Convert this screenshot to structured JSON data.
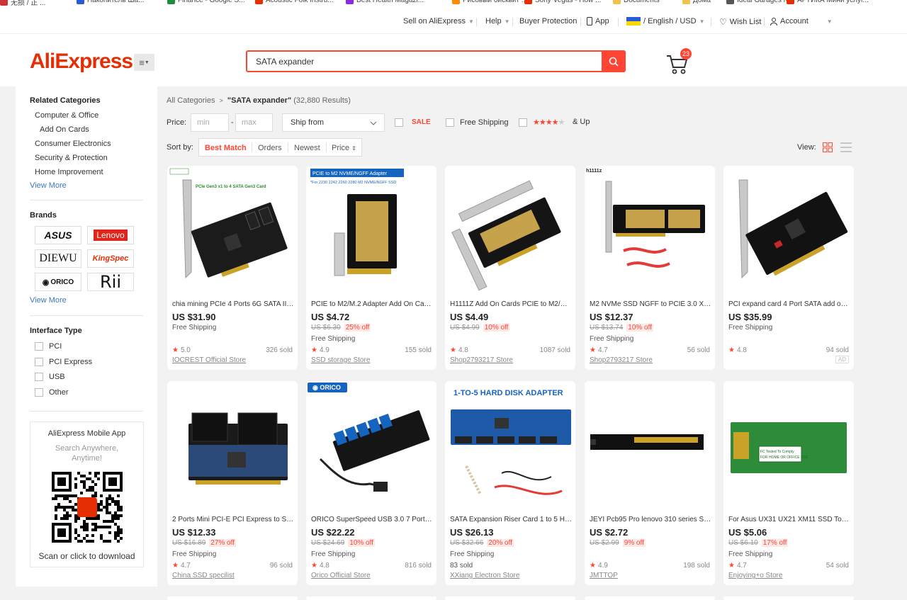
{
  "bookmarks": [
    {
      "label": "无损 / 正 ...",
      "color": "#c33"
    },
    {
      "label": "Накопитель Ша...",
      "color": "#2a5bd7"
    },
    {
      "label": "Finance - Google S...",
      "color": "#1e8e3e"
    },
    {
      "label": "Acoustic Folk Instru...",
      "color": "#e62e04"
    },
    {
      "label": "Best Health Magazi...",
      "color": "#8a2be2"
    },
    {
      "label": "Рисовый бисквит ...",
      "color": "#ff8c00"
    },
    {
      "label": "Sony Vegas - How ...",
      "color": "#e62e04"
    },
    {
      "label": "Documents",
      "color": "#f2c14e"
    },
    {
      "label": "Дома",
      "color": "#f2c14e"
    },
    {
      "label": "Ideal Garages NS",
      "color": "#555"
    },
    {
      "label": "АРТИКА Мини услуг...",
      "color": "#e62e04"
    }
  ],
  "topnav": {
    "sell": "Sell on AliExpress",
    "help": "Help",
    "buyer_protection": "Buyer Protection",
    "app": "App",
    "language_currency": "/ English /  USD",
    "wishlist": "Wish List",
    "account": "Account"
  },
  "header": {
    "logo": "AliExpress",
    "search_value": "SATA expander",
    "cart_count": "23"
  },
  "sidebar": {
    "related_title": "Related Categories",
    "related": [
      "Computer & Office",
      "Add On Cards",
      "Consumer Electronics",
      "Security & Protection",
      "Home Improvement"
    ],
    "view_more": "View More",
    "brands_title": "Brands",
    "brands": [
      "ASUS",
      "Lenovo",
      "DIEWU",
      "KingSpec",
      "ORICO",
      "Rii"
    ],
    "interface_title": "Interface Type",
    "interfaces": [
      "PCI",
      "PCI Express",
      "USB",
      "Other"
    ],
    "app_title": "AliExpress Mobile App",
    "app_sub": "Search Anywhere, Anytime!",
    "app_cta": "Scan or click to download"
  },
  "breadcrumb": {
    "all": "All Categories",
    "sep": ">",
    "query": "\"SATA expander\"",
    "count": "(32,880 Results)"
  },
  "filters": {
    "price_label": "Price:",
    "min": "min",
    "dash": "-",
    "max": "max",
    "ship_from": "Ship from",
    "sale": "SALE",
    "free_shipping": "Free Shipping",
    "stars": "★★★★★",
    "and_up": "& Up",
    "star_rating": 4
  },
  "sort": {
    "label": "Sort by:",
    "options": [
      "Best Match",
      "Orders",
      "Newest",
      "Price"
    ],
    "view_label": "View:"
  },
  "colors": {
    "accent": "#f43",
    "brand": "#e62e04",
    "link": "#3a77c2"
  },
  "products": [
    {
      "title": "chia mining PCIe 4 Ports 6G SATA III PCIE Expansion Card",
      "price": "US $31.90",
      "old": "",
      "discount": "",
      "shipping": "Free Shipping",
      "rating": "5.0",
      "sold": "326 sold",
      "store": "IOCREST Official Store",
      "image_label": "PCIe Gen3 x1 to 4 SATA Gen3 Card",
      "ad": ""
    },
    {
      "title": "PCIE to M2/M.2 Adapter Add On Cards",
      "price": "US $4.72",
      "old": "US $6.30",
      "discount": "25% off",
      "shipping": "Free Shipping",
      "rating": "4.9",
      "sold": "155 sold",
      "store": "SSD storage Store",
      "image_label": "PCIE to M2 NVME/NGFF Adapter",
      "ad": ""
    },
    {
      "title": "H1111Z Add On Cards PCIE to M2/M.2 Adapter",
      "price": "US $4.49",
      "old": "US $4.99",
      "discount": "10% off",
      "shipping": "",
      "rating": "4.8",
      "sold": "1087 sold",
      "store": "Shop2793217 Store",
      "image_label": "",
      "ad": ""
    },
    {
      "title": "M2 NVMe SSD NGFF to PCIE 3.0 X16 Adapter",
      "price": "US $12.37",
      "old": "US $13.74",
      "discount": "10% off",
      "shipping": "Free Shipping",
      "rating": "4.7",
      "sold": "56 sold",
      "store": "Shop2793217 Store",
      "image_label": "h1111z",
      "ad": ""
    },
    {
      "title": "PCI expand card 4 Port SATA add on card",
      "price": "US $35.99",
      "old": "",
      "discount": "",
      "shipping": "Free Shipping",
      "rating": "4.8",
      "sold": "94 sold",
      "store": "",
      "image_label": "",
      "ad": "AD"
    },
    {
      "title": "2 Ports Mini PCI-E PCI Express to SATA 3.0",
      "price": "US $12.33",
      "old": "US $16.89",
      "discount": "27% off",
      "shipping": "Free Shipping",
      "rating": "4.7",
      "sold": "96 sold",
      "store": "China SSD specilist",
      "image_label": "",
      "ad": ""
    },
    {
      "title": "ORICO SuperSpeed USB 3.0 7 Port PCI Express",
      "price": "US $22.22",
      "old": "US $24.69",
      "discount": "10% off",
      "shipping": "Free Shipping",
      "rating": "4.8",
      "sold": "816 sold",
      "store": "Orico Official Store",
      "image_label": "ORICO",
      "ad": ""
    },
    {
      "title": "SATA Expansion Riser Card 1 to 5 Hard Disk Adapter",
      "price": "US $26.13",
      "old": "US $32.66",
      "discount": "20% off",
      "shipping": "Free Shipping",
      "rating": "",
      "sold": "83 sold",
      "store": "XXiang Electron Store",
      "image_label": "1-TO-5 HARD DISK ADAPTER",
      "ad": ""
    },
    {
      "title": "JEYI Pcb95 Pro lenovo 310 series SSD Adapter",
      "price": "US $2.72",
      "old": "US $2.99",
      "discount": "9% off",
      "shipping": "",
      "rating": "4.9",
      "sold": "198 sold",
      "store": "JMTTOP",
      "image_label": "",
      "ad": ""
    },
    {
      "title": "For Asus UX31 UX21 XM11 SSD To SATA Adapter",
      "price": "US $5.06",
      "old": "US $6.10",
      "discount": "17% off",
      "shipping": "Free Shipping",
      "rating": "4.7",
      "sold": "54 sold",
      "store": "Enjoying+o Store",
      "image_label": "",
      "ad": ""
    }
  ]
}
